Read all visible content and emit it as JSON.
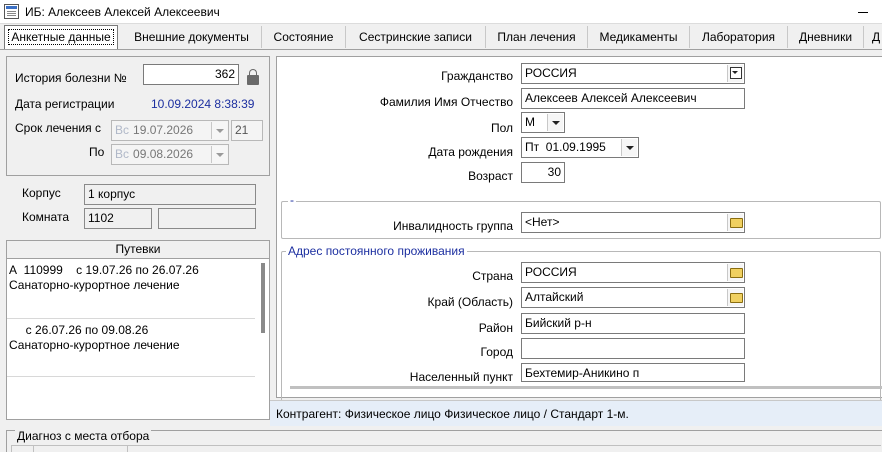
{
  "window": {
    "title": "ИБ: Алексеев Алексей Алексеевич"
  },
  "tabs": [
    {
      "label": "Анкетные данные",
      "active": true
    },
    {
      "label": "Внешние документы"
    },
    {
      "label": "Состояние"
    },
    {
      "label": "Сестринские записи"
    },
    {
      "label": "План лечения"
    },
    {
      "label": "Медикаменты"
    },
    {
      "label": "Лаборатория"
    },
    {
      "label": "Дневники"
    },
    {
      "label": "Д"
    }
  ],
  "record": {
    "history_label": "История болезни №",
    "history_number": "362",
    "reg_label": "Дата регистрации",
    "reg_value": "10.09.2024 8:38:39",
    "term_label": "Срок лечения с",
    "term_from": {
      "prefix": "Вс",
      "date": "19.07.2026"
    },
    "term_days": "21",
    "term_to_label": "По",
    "term_to": {
      "prefix": "Вс",
      "date": "09.08.2026"
    }
  },
  "location": {
    "building_label": "Корпус",
    "building_value": "1 корпус",
    "room_label": "Комната",
    "room_value": "1102",
    "room_extra": ""
  },
  "vouchers": {
    "header": "Путевки",
    "items": [
      {
        "line1": "А  110999    с 19.07.26 по 26.07.26",
        "line2": "Санаторно-курортное лечение"
      },
      {
        "line1": "     с 26.07.26 по 09.08.26",
        "line2": "Санаторно-курортное лечение"
      }
    ]
  },
  "person": {
    "citizenship_label": "Гражданство",
    "citizenship_value": "РОССИЯ",
    "fio_label": "Фамилия Имя Отчество",
    "fio_value": "Алексеев Алексей Алексеевич",
    "sex_label": "Пол",
    "sex_value": "М",
    "birth_label": "Дата рождения",
    "birth_value": "Пт  01.09.1995",
    "age_label": "Возраст",
    "age_value": "30"
  },
  "disability": {
    "group_caption": "-",
    "label": "Инвалидность группа",
    "value": "<Нет>"
  },
  "address": {
    "group_caption": "Адрес постоянного проживания",
    "country_label": "Страна",
    "country_value": "РОССИЯ",
    "region_label": "Край (Область)",
    "region_value": "Алтайский",
    "district_label": "Район",
    "district_value": "Бийский р-н",
    "city_label": "Город",
    "city_value": "",
    "settlement_label": "Населенный пункт",
    "settlement_value": "Бехтемир-Аникино п"
  },
  "status_text": "Контрагент: Физическое лицо Физическое лицо  / Стандарт 1-м.",
  "diagnosis": {
    "group_caption": "Диагноз с места отбора"
  },
  "colors": {
    "accent": "#1c2fa0",
    "status_bg": "#e6eef8"
  }
}
